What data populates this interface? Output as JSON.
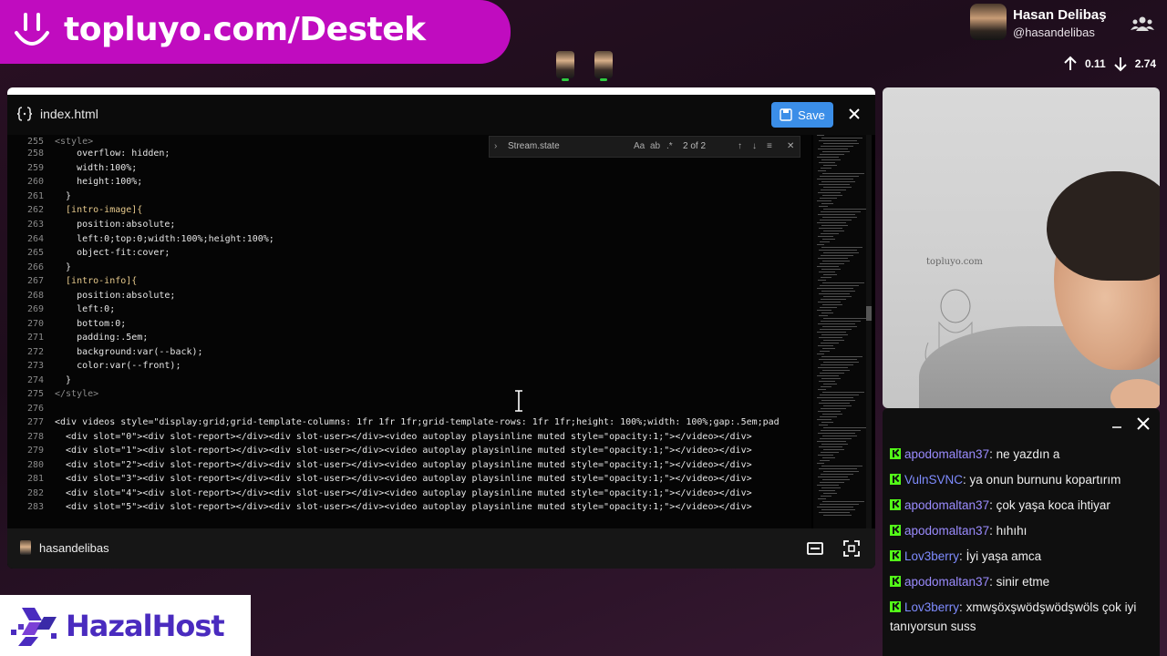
{
  "banner": {
    "text": "topluyo.com/Destek"
  },
  "profile": {
    "name": "Hasan Delibaş",
    "handle": "@hasandelibas",
    "upload": "0.11",
    "download": "2.74"
  },
  "editor": {
    "filename": "index.html",
    "save_label": "Save",
    "find": {
      "query": "Stream.state",
      "count": "2 of 2",
      "case_label": "Aa"
    },
    "lines": [
      {
        "n": "255",
        "t": "<style>"
      },
      {
        "n": "258",
        "t": "    overflow: hidden;"
      },
      {
        "n": "259",
        "t": "    width:100%;"
      },
      {
        "n": "260",
        "t": "    height:100%;"
      },
      {
        "n": "261",
        "t": "  }"
      },
      {
        "n": "262",
        "t": "  [intro-image]{"
      },
      {
        "n": "263",
        "t": "    position:absolute;"
      },
      {
        "n": "264",
        "t": "    left:0;top:0;width:100%;height:100%;"
      },
      {
        "n": "265",
        "t": "    object-fit:cover;"
      },
      {
        "n": "266",
        "t": "  }"
      },
      {
        "n": "267",
        "t": "  [intro-info]{"
      },
      {
        "n": "268",
        "t": "    position:absolute;"
      },
      {
        "n": "269",
        "t": "    left:0;"
      },
      {
        "n": "270",
        "t": "    bottom:0;"
      },
      {
        "n": "271",
        "t": "    padding:.5em;"
      },
      {
        "n": "272",
        "t": "    background:var(--back);"
      },
      {
        "n": "273",
        "t": "    color:var(--front);"
      },
      {
        "n": "274",
        "t": "  }"
      },
      {
        "n": "275",
        "t": "</style>"
      },
      {
        "n": "276",
        "t": ""
      },
      {
        "n": "277",
        "t": "<div videos style=\"display:grid;grid-template-columns: 1fr 1fr 1fr;grid-template-rows: 1fr 1fr;height: 100%;width: 100%;gap:.5em;pad"
      },
      {
        "n": "278",
        "t": "  <div slot=\"0\"><div slot-report></div><div slot-user></div><video autoplay playsinline muted style=\"opacity:1;\"></video></div>"
      },
      {
        "n": "279",
        "t": "  <div slot=\"1\"><div slot-report></div><div slot-user></div><video autoplay playsinline muted style=\"opacity:1;\"></video></div>"
      },
      {
        "n": "280",
        "t": "  <div slot=\"2\"><div slot-report></div><div slot-user></div><video autoplay playsinline muted style=\"opacity:1;\"></video></div>"
      },
      {
        "n": "281",
        "t": "  <div slot=\"3\"><div slot-report></div><div slot-user></div><video autoplay playsinline muted style=\"opacity:1;\"></video></div>"
      },
      {
        "n": "282",
        "t": "  <div slot=\"4\"><div slot-report></div><div slot-user></div><video autoplay playsinline muted style=\"opacity:1;\"></video></div>"
      },
      {
        "n": "283",
        "t": "  <div slot=\"5\"><div slot-report></div><div slot-user></div><video autoplay playsinline muted style=\"opacity:1;\"></video></div>"
      }
    ]
  },
  "stream_footer": {
    "username": "hasandelibas"
  },
  "webcam": {
    "board_text": "topluyo.com"
  },
  "chat": {
    "messages": [
      {
        "user": "apodomaltan37",
        "text": "ne yazdın a"
      },
      {
        "user": "VulnSVNC",
        "text": "ya onun burnunu kopartırım"
      },
      {
        "user": "apodomaltan37",
        "text": "çok yaşa koca ihtiyar"
      },
      {
        "user": "apodomaltan37",
        "text": "hıhıhı"
      },
      {
        "user": "Lov3berry",
        "text": "İyi yaşa amca"
      },
      {
        "user": "apodomaltan37",
        "text": "sinir etme"
      },
      {
        "user": "Lov3berry",
        "text": "xmwşöxşwödşwödşwöls çok iyi tanıyorsun suss"
      }
    ]
  },
  "sponsor": {
    "text": "HazalHost"
  },
  "colors": {
    "banner": "#c00cbf",
    "save": "#3b8ee8",
    "kick_green": "#53fc18",
    "sponsor": "#4a2bbf"
  }
}
